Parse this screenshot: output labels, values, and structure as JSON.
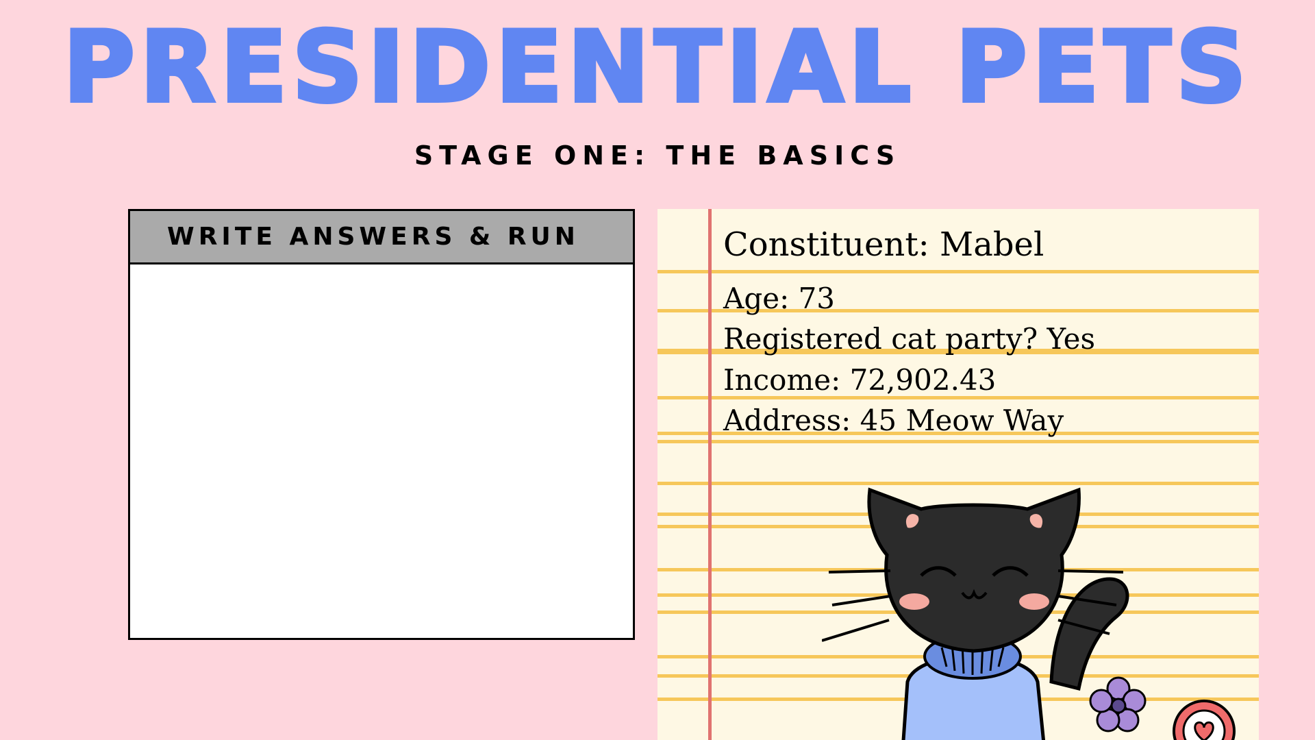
{
  "header": {
    "title": "PRESIDENTIAL PETS",
    "subtitle": "STAGE ONE: THE BASICS"
  },
  "answer_panel": {
    "header_label": "WRITE ANSWERS & RUN",
    "value": ""
  },
  "profile": {
    "heading": "Constituent: Mabel",
    "fields": [
      {
        "text": "Age: 73"
      },
      {
        "text": "Registered cat party? Yes"
      },
      {
        "text": "Income: 72,902.43"
      },
      {
        "text": "Address: 45 Meow Way"
      }
    ]
  },
  "icons": {
    "illustration": "black-cat-illustration",
    "flower": "flower-icon",
    "badge": "heart-badge-icon"
  },
  "colors": {
    "background": "#fed6dd",
    "title": "#6086f2",
    "panel_header": "#aaaaaa",
    "notepad": "#fef8e4",
    "notepad_lines": "#f6c75a",
    "margin_line": "#e07370",
    "cat_fur": "#2b2b2b",
    "cat_sweater": "#a4c0fa"
  }
}
